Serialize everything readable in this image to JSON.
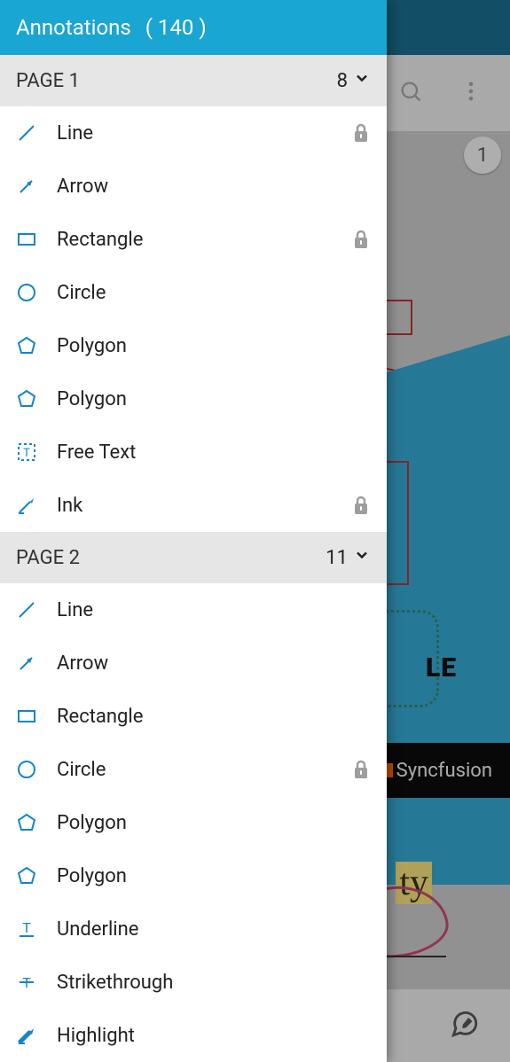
{
  "colors": {
    "accent": "#1aa6d2",
    "iconBlue": "#1585c8",
    "lockGray": "#9e9e9e"
  },
  "panel": {
    "title": "Annotations",
    "countText": "( 140 )"
  },
  "sections": [
    {
      "title": "PAGE 1",
      "count": "8",
      "items": [
        {
          "label": "Line",
          "icon": "line",
          "locked": true
        },
        {
          "label": "Arrow",
          "icon": "arrow",
          "locked": false
        },
        {
          "label": "Rectangle",
          "icon": "rectangle",
          "locked": true
        },
        {
          "label": "Circle",
          "icon": "circle",
          "locked": false
        },
        {
          "label": "Polygon",
          "icon": "polygon",
          "locked": false
        },
        {
          "label": "Polygon",
          "icon": "polygon",
          "locked": false
        },
        {
          "label": "Free Text",
          "icon": "freetext",
          "locked": false
        },
        {
          "label": "Ink",
          "icon": "ink",
          "locked": true
        }
      ]
    },
    {
      "title": "PAGE 2",
      "count": "11",
      "items": [
        {
          "label": "Line",
          "icon": "line",
          "locked": false
        },
        {
          "label": "Arrow",
          "icon": "arrow",
          "locked": false
        },
        {
          "label": "Rectangle",
          "icon": "rectangle",
          "locked": false
        },
        {
          "label": "Circle",
          "icon": "circle",
          "locked": true
        },
        {
          "label": "Polygon",
          "icon": "polygon",
          "locked": false
        },
        {
          "label": "Polygon",
          "icon": "polygon",
          "locked": false
        },
        {
          "label": "Underline",
          "icon": "underline",
          "locked": false
        },
        {
          "label": "Strikethrough",
          "icon": "strikethrough",
          "locked": false
        },
        {
          "label": "Highlight",
          "icon": "highlight",
          "locked": false
        }
      ]
    }
  ],
  "background": {
    "pageBadge": "1",
    "titleSnippet": "LE",
    "brand": "Syncfusion",
    "highlightSnippet": "ty"
  }
}
